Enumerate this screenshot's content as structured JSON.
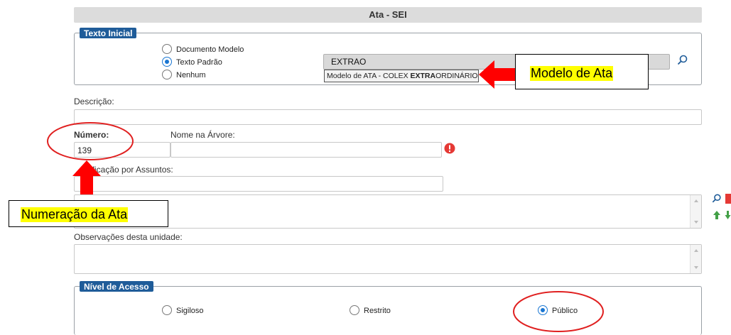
{
  "header": {
    "title": "Ata - SEI"
  },
  "texto_inicial": {
    "legend": "Texto Inicial",
    "options": [
      "Documento Modelo",
      "Texto Padrão",
      "Nenhum"
    ],
    "selected_index": 1,
    "input_value": "EXTRAO",
    "suggestion_prefix": "Modelo de ATA - COLEX ",
    "suggestion_bold": "EXTRA",
    "suggestion_suffix": "ORDINÁRIO"
  },
  "descricao": {
    "label": "Descrição:",
    "value": ""
  },
  "numero": {
    "label": "Número:",
    "value": "139"
  },
  "nome_arvore": {
    "label": "Nome na Árvore:",
    "value": ""
  },
  "classificacao": {
    "label_visible": "ificação por Assuntos:",
    "value": ""
  },
  "observacoes": {
    "label": "Observações desta unidade:",
    "value": ""
  },
  "nivel_acesso": {
    "legend": "Nível de Acesso",
    "options": [
      "Sigiloso",
      "Restrito",
      "Público"
    ],
    "selected_index": 2
  },
  "annotations": {
    "modelo": "Modelo de Ata",
    "numeracao": "Numeração da Ata"
  },
  "colors": {
    "accent": "#1f5c99",
    "radio": "#1976d2",
    "callout_arrow": "#ff0000",
    "highlight": "#ffff00"
  }
}
